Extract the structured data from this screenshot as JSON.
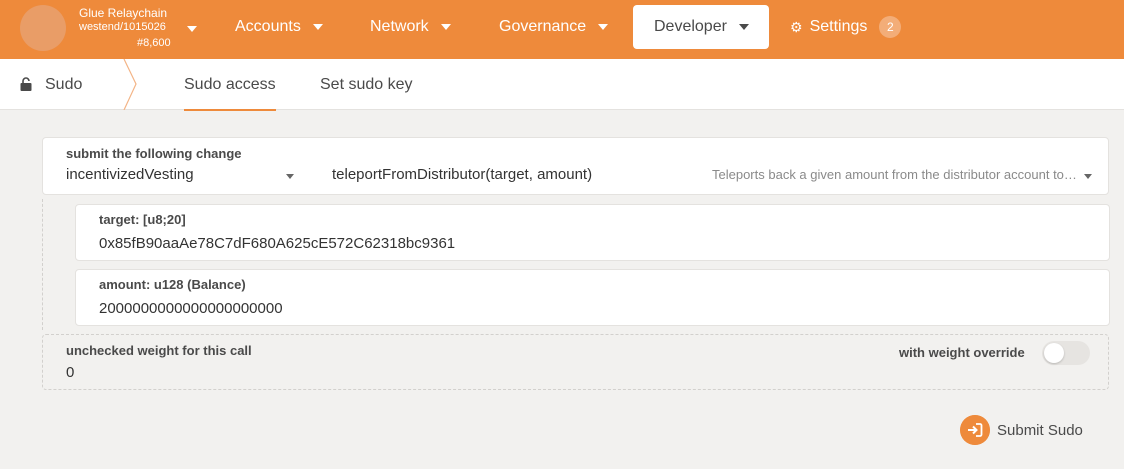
{
  "chain": {
    "name": "Glue Relaychain",
    "version": "westend/1015026",
    "block": "#8,600"
  },
  "nav": {
    "items": [
      {
        "label": "Accounts"
      },
      {
        "label": "Network"
      },
      {
        "label": "Governance"
      },
      {
        "label": "Developer",
        "active": true
      },
      {
        "label": "Settings",
        "badge": "2"
      }
    ]
  },
  "subnav": {
    "section": "Sudo",
    "tabs": [
      {
        "label": "Sudo access",
        "active": true
      },
      {
        "label": "Set sudo key"
      }
    ]
  },
  "form": {
    "call_label": "submit the following change",
    "section": "incentivizedVesting",
    "method": "teleportFromDistributor(target, amount)",
    "method_doc": "Teleports back a given amount from the distributor account to the relaychain",
    "params": [
      {
        "label": "target: [u8;20]",
        "value": "0x85fB90aaAe78C7dF680A625cE572C62318bc9361"
      },
      {
        "label": "amount: u128 (Balance)",
        "value": "2000000000000000000000"
      }
    ],
    "weight": {
      "label": "unchecked weight for this call",
      "value": "0",
      "override_label": "with weight override",
      "override_enabled": false
    },
    "submit_label": "Submit Sudo"
  },
  "colors": {
    "accent": "#ee8a3b",
    "background": "#f2f1ef"
  }
}
